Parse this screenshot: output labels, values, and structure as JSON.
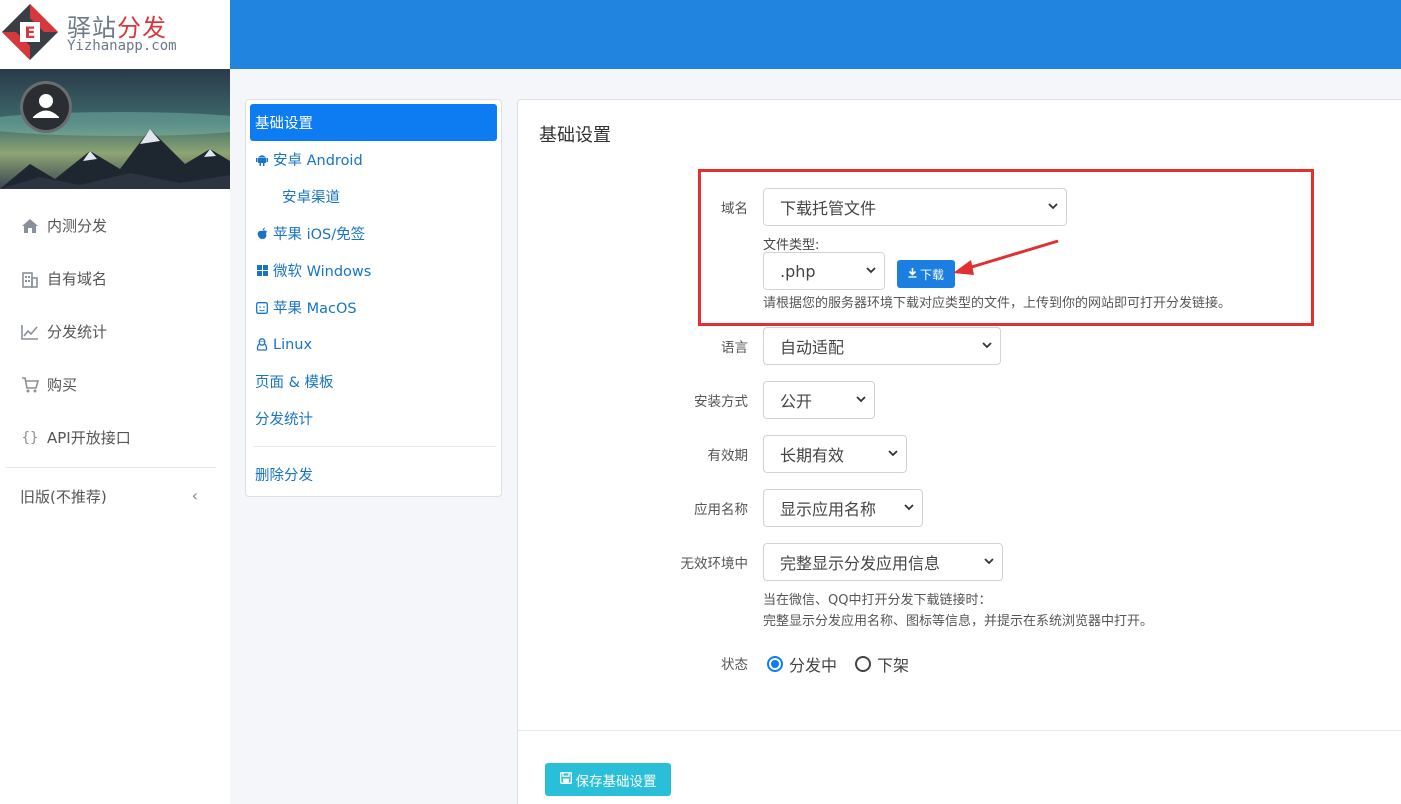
{
  "brand": {
    "name_part1": "驿站",
    "name_part2": "分发",
    "subtitle": "Yizhanapp.com"
  },
  "colors": {
    "topbar": "#2185e0",
    "accent": "#0d7cf2",
    "highlight": "#e0302f",
    "save_button": "#29bfd8"
  },
  "sidebar": {
    "items": [
      {
        "icon": "home-icon",
        "label": "内测分发"
      },
      {
        "icon": "building-icon",
        "label": "自有域名"
      },
      {
        "icon": "chart-line-icon",
        "label": "分发统计"
      },
      {
        "icon": "cart-icon",
        "label": "购买"
      },
      {
        "icon": "braces-icon",
        "label": "API开放接口"
      }
    ],
    "old_version": "旧版(不推荐)"
  },
  "submenu": {
    "items": [
      {
        "icon": "",
        "label": "基础设置"
      },
      {
        "icon": "android-icon",
        "label": "安卓 Android"
      },
      {
        "icon": "",
        "label": "安卓渠道"
      },
      {
        "icon": "apple-icon",
        "label": "苹果 iOS/免签"
      },
      {
        "icon": "windows-icon",
        "label": "微软 Windows"
      },
      {
        "icon": "macos-icon",
        "label": "苹果 MacOS"
      },
      {
        "icon": "linux-icon",
        "label": "Linux"
      },
      {
        "icon": "",
        "label": "页面 & 模板"
      },
      {
        "icon": "",
        "label": "分发统计"
      }
    ],
    "delete": "删除分发"
  },
  "main": {
    "title": "基础设置",
    "domain": {
      "label": "域名",
      "value": "下载托管文件",
      "file_type_label": "文件类型:",
      "file_type_value": ".php",
      "download_label": "下载",
      "help": "请根据您的服务器环境下载对应类型的文件，上传到你的网站即可打开分发链接。"
    },
    "language": {
      "label": "语言",
      "value": "自动适配"
    },
    "install": {
      "label": "安装方式",
      "value": "公开"
    },
    "validity": {
      "label": "有效期",
      "value": "长期有效"
    },
    "app_name": {
      "label": "应用名称",
      "value": "显示应用名称"
    },
    "invalid_env": {
      "label": "无效环境中",
      "value": "完整显示分发应用信息",
      "help1": "当在微信、QQ中打开分发下载链接时：",
      "help2": "完整显示分发应用名称、图标等信息，并提示在系统浏览器中打开。"
    },
    "status": {
      "label": "状态",
      "option_on": "分发中",
      "option_off": "下架",
      "selected": "分发中"
    },
    "save_label": "保存基础设置"
  }
}
